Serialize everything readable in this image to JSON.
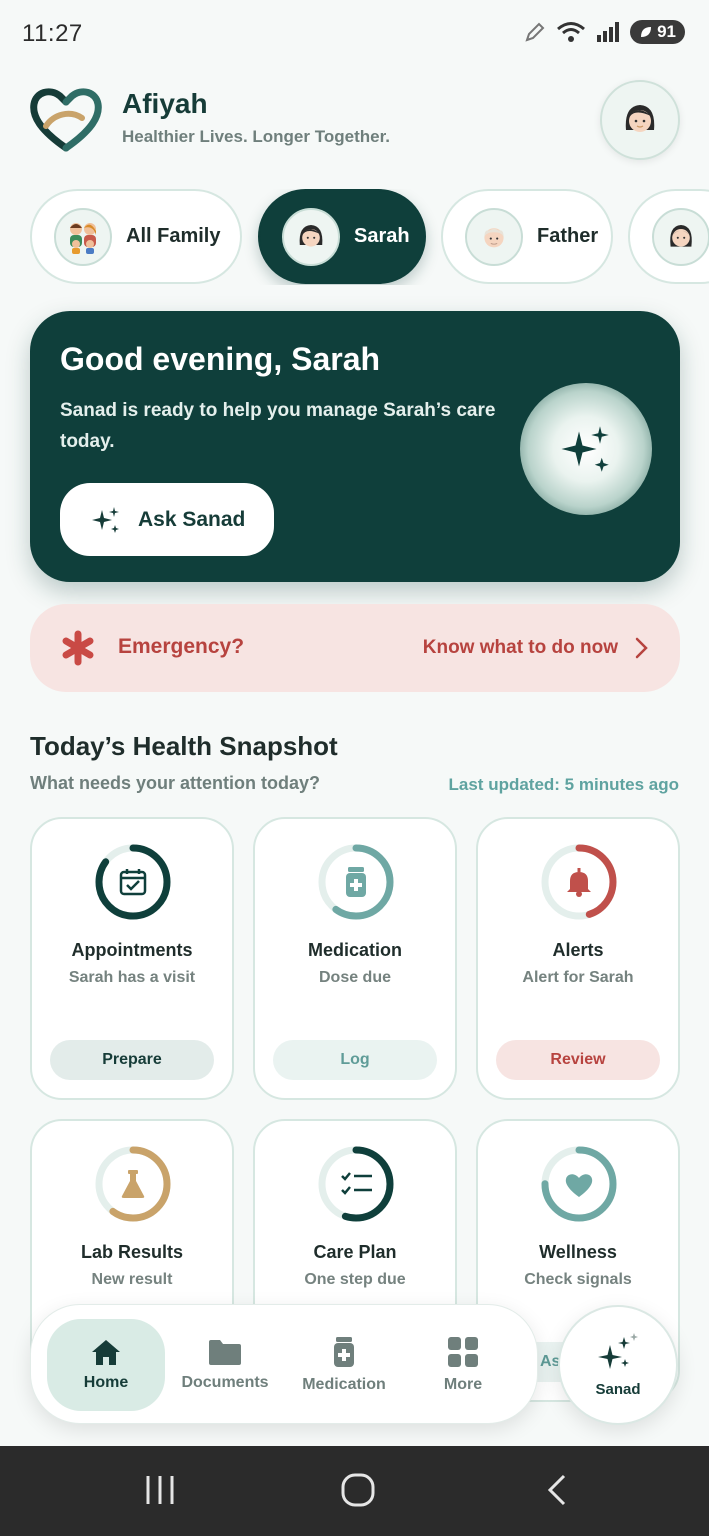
{
  "status_bar": {
    "time": "11:27",
    "battery": "91"
  },
  "header": {
    "brand": "Afiyah",
    "tagline": "Healthier Lives. Longer Together."
  },
  "family_chips": [
    {
      "label": "All Family",
      "active": false
    },
    {
      "label": "Sarah",
      "active": true
    },
    {
      "label": "Father",
      "active": false
    },
    {
      "label": "",
      "active": false
    }
  ],
  "hero": {
    "greeting": "Good evening, Sarah",
    "message": "Sanad is ready to help you manage Sarah’s care today.",
    "button": "Ask Sanad"
  },
  "emergency": {
    "label": "Emergency?",
    "link": "Know what to do now"
  },
  "snapshot": {
    "title": "Today’s Health Snapshot",
    "subtitle": "What needs your attention today?",
    "updated": "Last updated: 5 minutes ago",
    "cards": [
      {
        "title": "Appointments",
        "subtitle": "Sarah has a visit",
        "action": "Prepare",
        "progress": 0.85,
        "icon": "calendar-check-icon",
        "color": "#0f3f3b"
      },
      {
        "title": "Medication",
        "subtitle": "Dose due",
        "action": "Log",
        "progress": 0.6,
        "icon": "pill-bottle-icon",
        "color": "#6fa8a4"
      },
      {
        "title": "Alerts",
        "subtitle": "Alert for Sarah",
        "action": "Review",
        "progress": 0.45,
        "icon": "bell-icon",
        "color": "#c0504b"
      },
      {
        "title": "Lab Results",
        "subtitle": "New result",
        "action": "",
        "progress": 0.6,
        "icon": "flask-icon",
        "color": "#c9a36a"
      },
      {
        "title": "Care Plan",
        "subtitle": "One step due",
        "action": "",
        "progress": 0.55,
        "icon": "checklist-icon",
        "color": "#0f3f3b"
      },
      {
        "title": "Wellness",
        "subtitle": "Check signals",
        "action": "As",
        "progress": 0.75,
        "icon": "heart-icon",
        "color": "#6fa8a4"
      }
    ]
  },
  "bottom_nav": [
    {
      "label": "Home",
      "icon": "home-icon",
      "active": true
    },
    {
      "label": "Documents",
      "icon": "folder-icon",
      "active": false
    },
    {
      "label": "Medication",
      "icon": "pill-bottle-icon",
      "active": false
    },
    {
      "label": "More",
      "icon": "grid-icon",
      "active": false
    }
  ],
  "sanad_fab": {
    "label": "Sanad"
  },
  "colors": {
    "primary": "#0f3f3b",
    "emergency_bg": "#f7e4e2",
    "emergency_text": "#b7433f",
    "accent": "#5fa3a0"
  }
}
